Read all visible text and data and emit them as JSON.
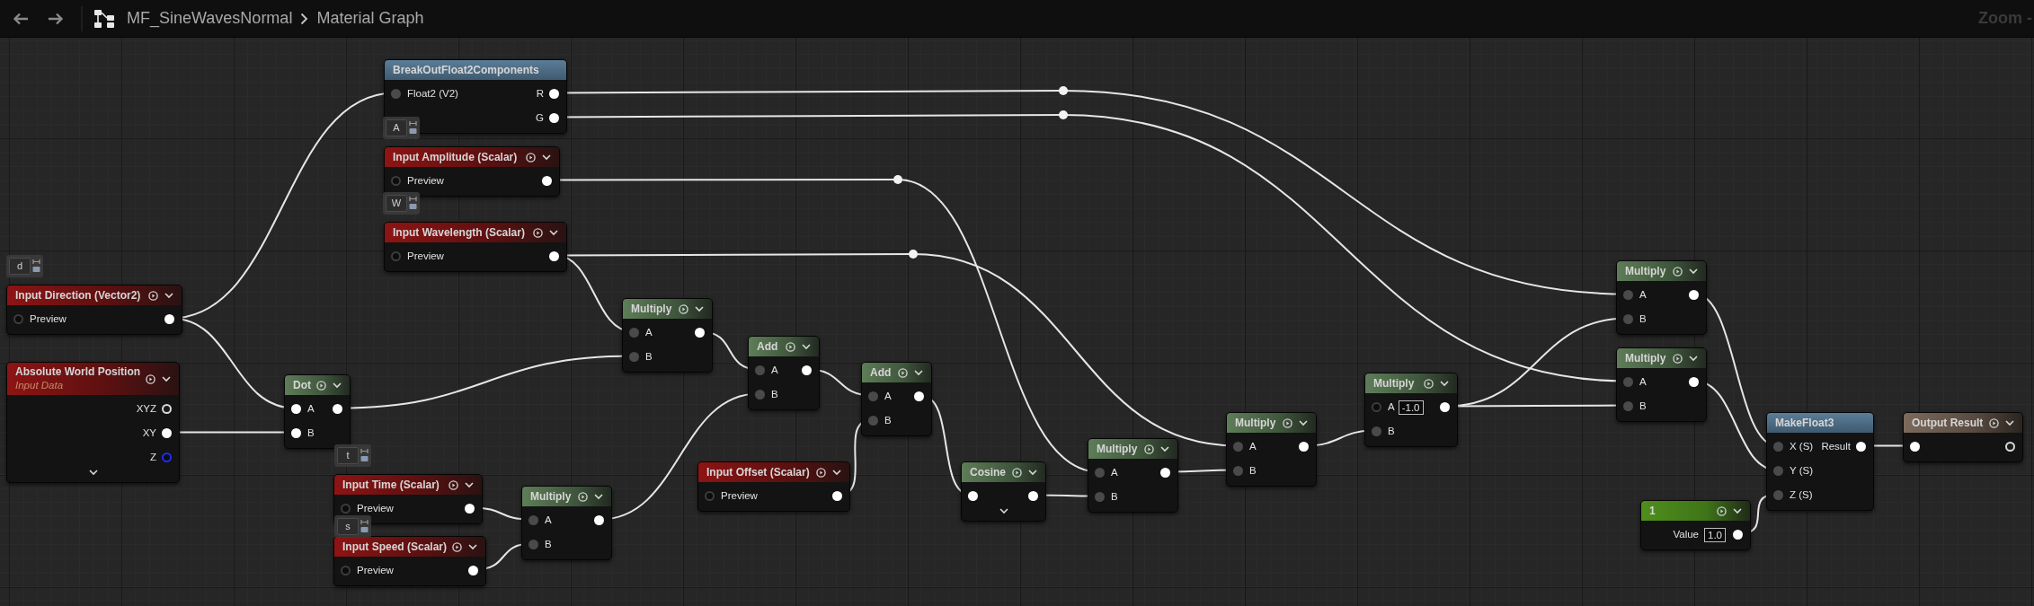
{
  "toolbar": {
    "asset": "MF_SineWavesNormal",
    "graph": "Material Graph",
    "zoom": "Zoom -"
  },
  "comments": [
    {
      "text": "A"
    },
    {
      "text": "W"
    },
    {
      "text": "d"
    },
    {
      "text": "t"
    },
    {
      "text": "s"
    }
  ],
  "nodes": [
    {
      "kind": "struct",
      "title": "BreakOutFloat2Components",
      "more": false,
      "inputs": [
        {
          "label": "Float2 (V2)",
          "kind": "dim"
        }
      ],
      "outputs": [
        {
          "label": "R",
          "kind": "filled"
        },
        {
          "label": "G",
          "kind": "filled"
        }
      ]
    },
    {
      "kind": "parameter",
      "title": "Input Amplitude (Scalar)",
      "more": false,
      "inputs": [
        {
          "label": "Preview",
          "kind": "hollow"
        }
      ],
      "outputs": [
        {
          "kind": "filled"
        }
      ]
    },
    {
      "kind": "parameter",
      "title": "Input Wavelength (Scalar)",
      "more": false,
      "inputs": [
        {
          "label": "Preview",
          "kind": "hollow"
        }
      ],
      "outputs": [
        {
          "kind": "filled"
        }
      ]
    },
    {
      "kind": "parameter",
      "title": "Input Direction (Vector2)",
      "more": false,
      "inputs": [
        {
          "label": "Preview",
          "kind": "hollow"
        }
      ],
      "outputs": [
        {
          "kind": "filled"
        }
      ]
    },
    {
      "kind": "parameter",
      "title": "Absolute World Position",
      "subtitle": "Input Data",
      "more": true,
      "outputs": [
        {
          "label": "XYZ",
          "kind": "ring"
        },
        {
          "label": "XY",
          "kind": "filled"
        },
        {
          "label": "Z",
          "kind": "blue"
        }
      ]
    },
    {
      "kind": "math",
      "title": "Dot",
      "more": false,
      "inputs": [
        {
          "label": "A",
          "kind": "filled"
        },
        {
          "label": "B",
          "kind": "filled"
        }
      ],
      "outputs": [
        {
          "kind": "filled"
        }
      ]
    },
    {
      "kind": "parameter",
      "title": "Input Time (Scalar)",
      "more": false,
      "inputs": [
        {
          "label": "Preview",
          "kind": "hollow"
        }
      ],
      "outputs": [
        {
          "kind": "filled"
        }
      ]
    },
    {
      "kind": "parameter",
      "title": "Input Speed (Scalar)",
      "more": false,
      "inputs": [
        {
          "label": "Preview",
          "kind": "hollow"
        }
      ],
      "outputs": [
        {
          "kind": "filled"
        }
      ]
    },
    {
      "kind": "math",
      "title": "Multiply",
      "more": false,
      "inputs": [
        {
          "label": "A",
          "kind": "dim"
        },
        {
          "label": "B",
          "kind": "dim"
        }
      ],
      "outputs": [
        {
          "kind": "filled"
        }
      ]
    },
    {
      "kind": "math",
      "title": "Multiply",
      "more": false,
      "inputs": [
        {
          "label": "A",
          "kind": "dim"
        },
        {
          "label": "B",
          "kind": "dim"
        }
      ],
      "outputs": [
        {
          "kind": "filled"
        }
      ]
    },
    {
      "kind": "math",
      "title": "Add",
      "more": false,
      "inputs": [
        {
          "label": "A",
          "kind": "dim"
        },
        {
          "label": "B",
          "kind": "dim"
        }
      ],
      "outputs": [
        {
          "kind": "filled"
        }
      ]
    },
    {
      "kind": "math",
      "title": "Add",
      "more": false,
      "inputs": [
        {
          "label": "A",
          "kind": "dim"
        },
        {
          "label": "B",
          "kind": "dim"
        }
      ],
      "outputs": [
        {
          "kind": "filled"
        }
      ]
    },
    {
      "kind": "parameter",
      "title": "Input Offset (Scalar)",
      "more": false,
      "inputs": [
        {
          "label": "Preview",
          "kind": "hollow"
        }
      ],
      "outputs": [
        {
          "kind": "filled"
        }
      ]
    },
    {
      "kind": "math",
      "title": "Cosine",
      "more": true,
      "inputs": [
        {
          "kind": "filled"
        }
      ],
      "outputs": [
        {
          "kind": "filled"
        }
      ]
    },
    {
      "kind": "math",
      "title": "Multiply",
      "more": false,
      "inputs": [
        {
          "label": "A",
          "kind": "dim"
        },
        {
          "label": "B",
          "kind": "dim"
        }
      ],
      "outputs": [
        {
          "kind": "filled"
        }
      ]
    },
    {
      "kind": "math",
      "title": "Multiply",
      "more": false,
      "inputs": [
        {
          "label": "A",
          "kind": "dim"
        },
        {
          "label": "B",
          "kind": "dim"
        }
      ],
      "outputs": [
        {
          "kind": "filled"
        }
      ]
    },
    {
      "kind": "math",
      "title": "Multiply",
      "more": false,
      "inputs": [
        {
          "label": "A",
          "value": "-1.0",
          "kind": "hollow"
        },
        {
          "label": "B",
          "kind": "dim"
        }
      ],
      "outputs": [
        {
          "kind": "filled"
        }
      ]
    },
    {
      "kind": "math",
      "title": "Multiply",
      "more": false,
      "inputs": [
        {
          "label": "A",
          "kind": "dim"
        },
        {
          "label": "B",
          "kind": "dim"
        }
      ],
      "outputs": [
        {
          "kind": "filled"
        }
      ]
    },
    {
      "kind": "math",
      "title": "Multiply",
      "more": false,
      "inputs": [
        {
          "label": "A",
          "kind": "dim"
        },
        {
          "label": "B",
          "kind": "dim"
        }
      ],
      "outputs": [
        {
          "kind": "filled"
        }
      ]
    },
    {
      "kind": "struct",
      "title": "MakeFloat3",
      "more": false,
      "inputs": [
        {
          "label": "X (S)",
          "kind": "dim"
        },
        {
          "label": "Y (S)",
          "kind": "dim"
        },
        {
          "label": "Z (S)",
          "kind": "dim"
        }
      ],
      "outputs": [
        {
          "label": "Result",
          "kind": "filled"
        }
      ]
    },
    {
      "kind": "constant",
      "title": "1",
      "more": false,
      "outputs": [
        {
          "label": "Value",
          "value": "1.0",
          "kind": "filled"
        }
      ]
    },
    {
      "kind": "output",
      "title": "Output Result",
      "more": false,
      "inputs": [
        {
          "kind": "filled"
        }
      ],
      "outputs": [
        {
          "kind": "ring"
        }
      ]
    }
  ]
}
